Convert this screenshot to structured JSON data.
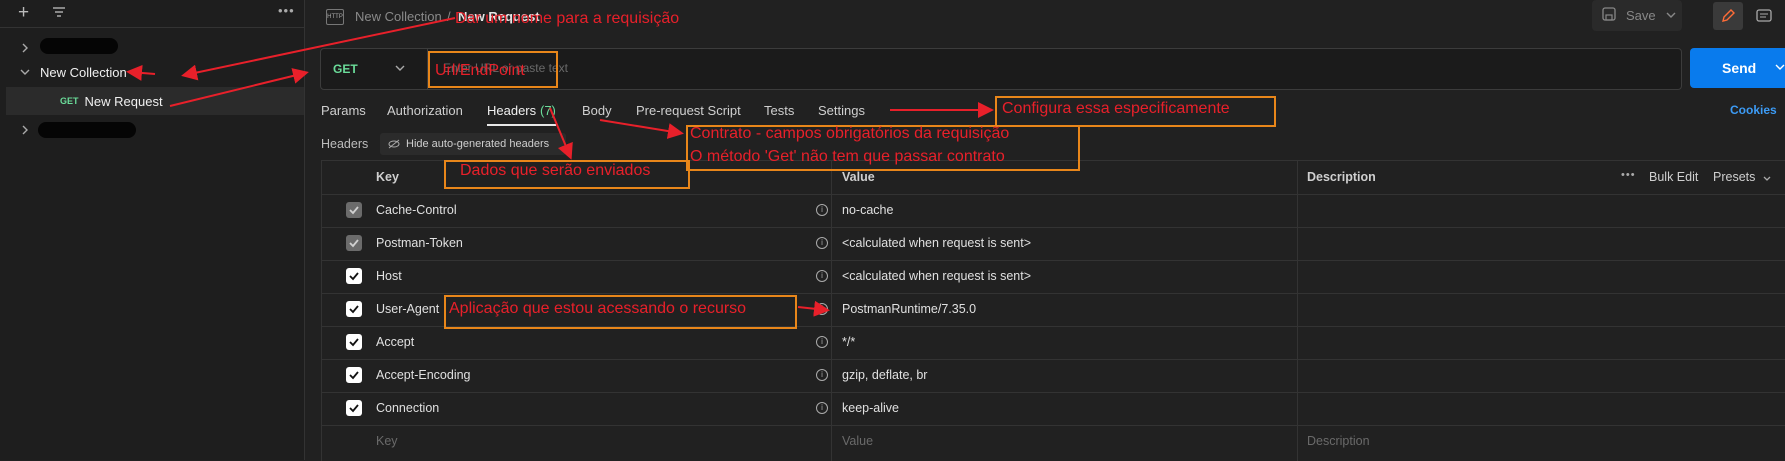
{
  "sidebar": {
    "collection_name": "New Collection",
    "request_method": "GET",
    "request_name": "New Request"
  },
  "topbar": {
    "breadcrumb_collection": "New Collection",
    "breadcrumb_sep": "/",
    "breadcrumb_request": "New Request",
    "save_label": "Save"
  },
  "request": {
    "method": "GET",
    "url_placeholder": "Enter URL or paste text",
    "send_label": "Send"
  },
  "tabs": [
    {
      "label": "Params"
    },
    {
      "label": "Authorization"
    },
    {
      "label": "Headers",
      "count": "(7)"
    },
    {
      "label": "Body"
    },
    {
      "label": "Pre-request Script"
    },
    {
      "label": "Tests"
    },
    {
      "label": "Settings"
    }
  ],
  "cookies_label": "Cookies",
  "headers_section": {
    "label": "Headers",
    "hide_auto_label": "Hide auto-generated headers"
  },
  "table": {
    "columns": {
      "key": "Key",
      "value": "Value",
      "description": "Description"
    },
    "bulk_edit": "Bulk Edit",
    "presets": "Presets",
    "rows": [
      {
        "key": "Cache-Control",
        "value": "no-cache",
        "checked": "dim"
      },
      {
        "key": "Postman-Token",
        "value": "<calculated when request is sent>",
        "checked": "dim"
      },
      {
        "key": "Host",
        "value": "<calculated when request is sent>",
        "checked": "on"
      },
      {
        "key": "User-Agent",
        "value": "PostmanRuntime/7.35.0",
        "checked": "on"
      },
      {
        "key": "Accept",
        "value": "*/*",
        "checked": "on"
      },
      {
        "key": "Accept-Encoding",
        "value": "gzip, deflate, br",
        "checked": "on"
      },
      {
        "key": "Connection",
        "value": "keep-alive",
        "checked": "on"
      }
    ],
    "new_row": {
      "key": "Key",
      "value": "Value",
      "description": "Description"
    }
  },
  "annotations": {
    "name_request": "Dar um nome para a requisição",
    "url_endpoint": "Url/EndPoint",
    "settings": "Configura essa especificamente",
    "contract_line1": "Contrato  - campos obrigatórios da requisição",
    "contract_line2": "O método 'Get' não tem que passar contrato",
    "data_sent": "Dados que serão enviados",
    "user_agent": "Aplicação que estou acessando o recurso"
  },
  "colors": {
    "accent": "#097bed",
    "get_method": "#6bdd9a",
    "annotation_text": "#e8202a",
    "annotation_box": "#e8861a"
  }
}
